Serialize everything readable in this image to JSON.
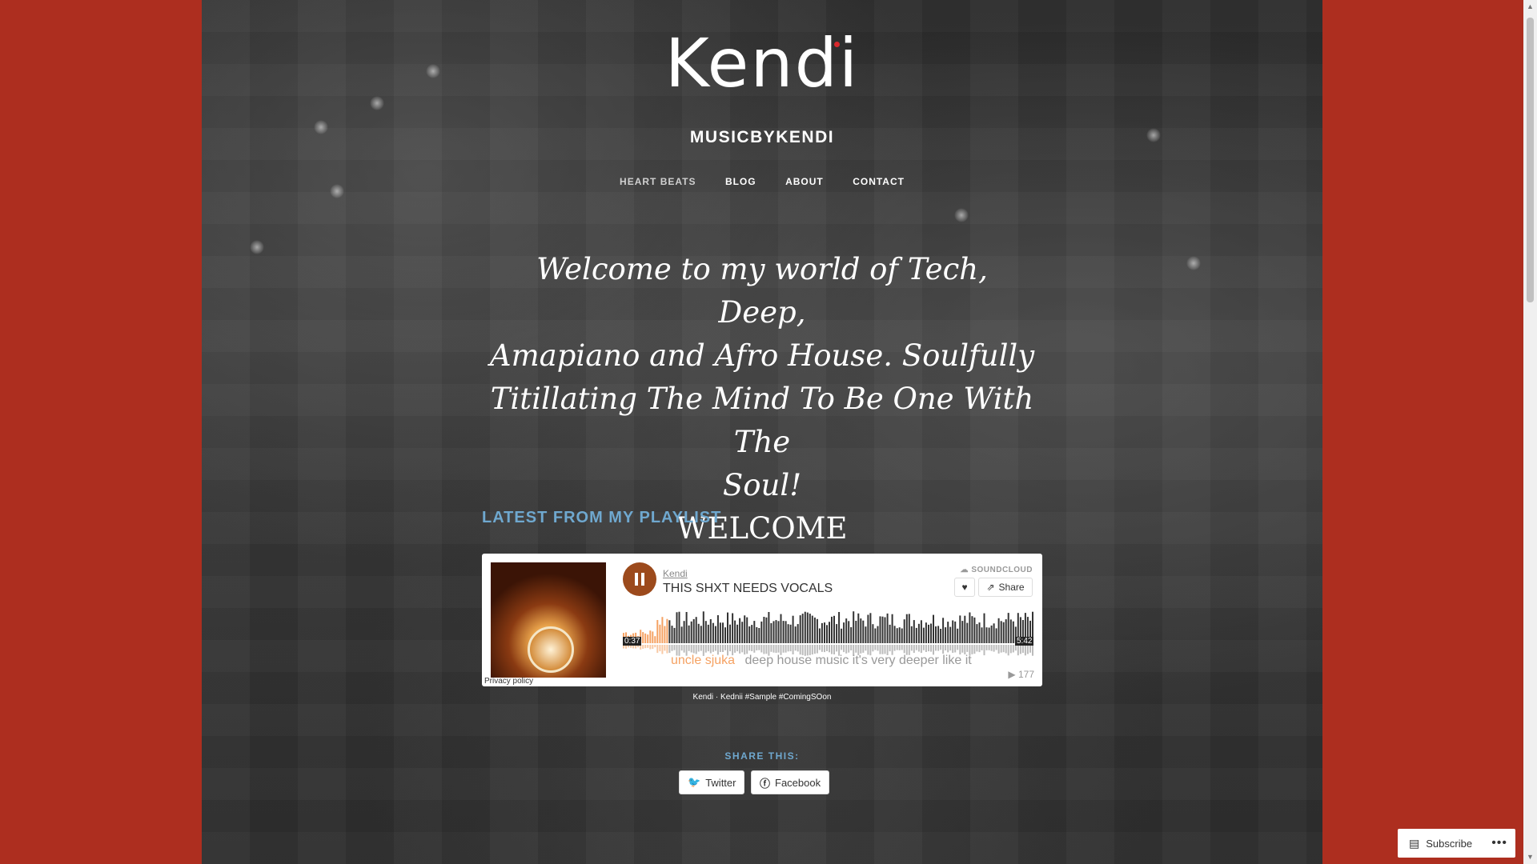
{
  "site": {
    "logo_text": "Kendi",
    "title": "MUSICBYKENDI"
  },
  "nav": [
    {
      "label": "HEART BEATS"
    },
    {
      "label": "BLOG"
    },
    {
      "label": "ABOUT"
    },
    {
      "label": "CONTACT"
    }
  ],
  "hero": {
    "line1": "Welcome to my world of Tech, Deep,",
    "line2": "Amapiano and Afro House. Soulfully",
    "line3": "Titillating The Mind To Be One With The",
    "line4": "Soul!",
    "welcome": "WELCOME"
  },
  "section": {
    "title": "LATEST FROM MY PLAYLIST"
  },
  "player": {
    "user": "Kendi",
    "track": "THIS SHXT NEEDS VOCALS",
    "brand": "SOUNDCLOUD",
    "share_label": "Share",
    "elapsed": "0:37",
    "duration": "5:42",
    "progress": 0.11,
    "comment_user": "uncle sjuka",
    "comment_text": "deep house music it's very deeper like it",
    "plays": "177",
    "privacy": "Privacy policy",
    "accent": "#f5a263"
  },
  "caption": {
    "artist": "Kendi",
    "sep": "·",
    "title": "Kednii #Sample #ComingSOon"
  },
  "share": {
    "title": "SHARE THIS:",
    "twitter": "Twitter",
    "facebook": "Facebook"
  },
  "subscribe": {
    "label": "Subscribe",
    "more": "•••"
  },
  "colors": {
    "background": "#ad2e1f",
    "accent": "#6fa8cf"
  }
}
